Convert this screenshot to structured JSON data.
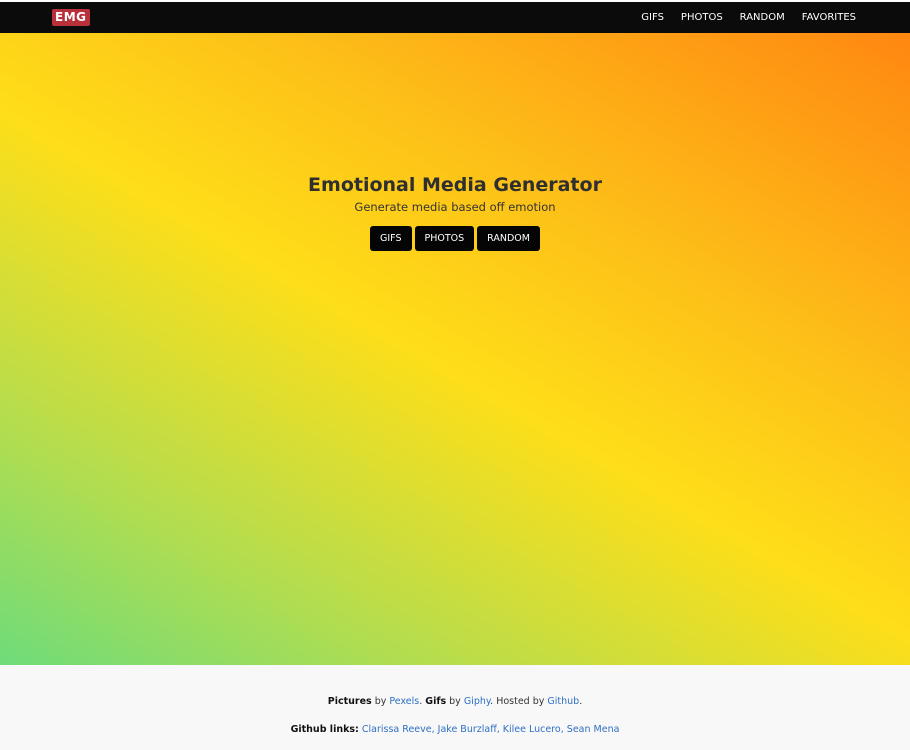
{
  "navbar": {
    "brand": "EMG",
    "links": [
      "GIFS",
      "PHOTOS",
      "RANDOM",
      "FAVORITES"
    ]
  },
  "hero": {
    "title": "Emotional Media Generator",
    "subtitle": "Generate media based off emotion",
    "buttons": [
      "GIFS",
      "PHOTOS",
      "RANDOM"
    ]
  },
  "footer": {
    "credits": {
      "pictures_label": "Pictures",
      "by1": " by ",
      "pictures_source": "Pexels",
      "sep1": ". ",
      "gifs_label": "Gifs",
      "by2": " by ",
      "gifs_source": "Giphy",
      "hosted_text": ". Hosted by ",
      "host": "Github",
      "end": "."
    },
    "github": {
      "label": "Github links:",
      "links": [
        "Clarissa Reeve,",
        "Jake Burzlaff,",
        "Kilee Lucero,",
        "Sean Mena"
      ]
    }
  },
  "colors": {
    "navbar_bg": "#0b0b0b",
    "brand_bg": "#b8303a",
    "link_color": "#2f6fc4",
    "gradient": [
      "#6edc7a",
      "#b6dd4d",
      "#fede18",
      "#fdc018",
      "#ff8711"
    ]
  }
}
